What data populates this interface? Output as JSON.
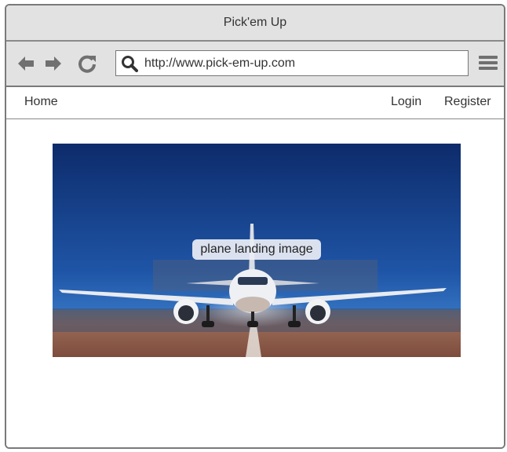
{
  "window": {
    "title": "Pick'em Up"
  },
  "toolbar": {
    "url": "http://www.pick-em-up.com",
    "back_icon": "arrow-left-icon",
    "forward_icon": "arrow-right-icon",
    "reload_icon": "reload-icon",
    "search_icon": "search-icon",
    "menu_icon": "hamburger-menu-icon"
  },
  "nav": {
    "home": "Home",
    "login": "Login",
    "register": "Register"
  },
  "hero": {
    "label": "plane landing image"
  },
  "colors": {
    "chrome": "#e2e2e2",
    "icon": "#707070",
    "sky_top": "#0d2b6b",
    "sky_bottom": "#2f73c4",
    "runway": "#8a5a48"
  }
}
